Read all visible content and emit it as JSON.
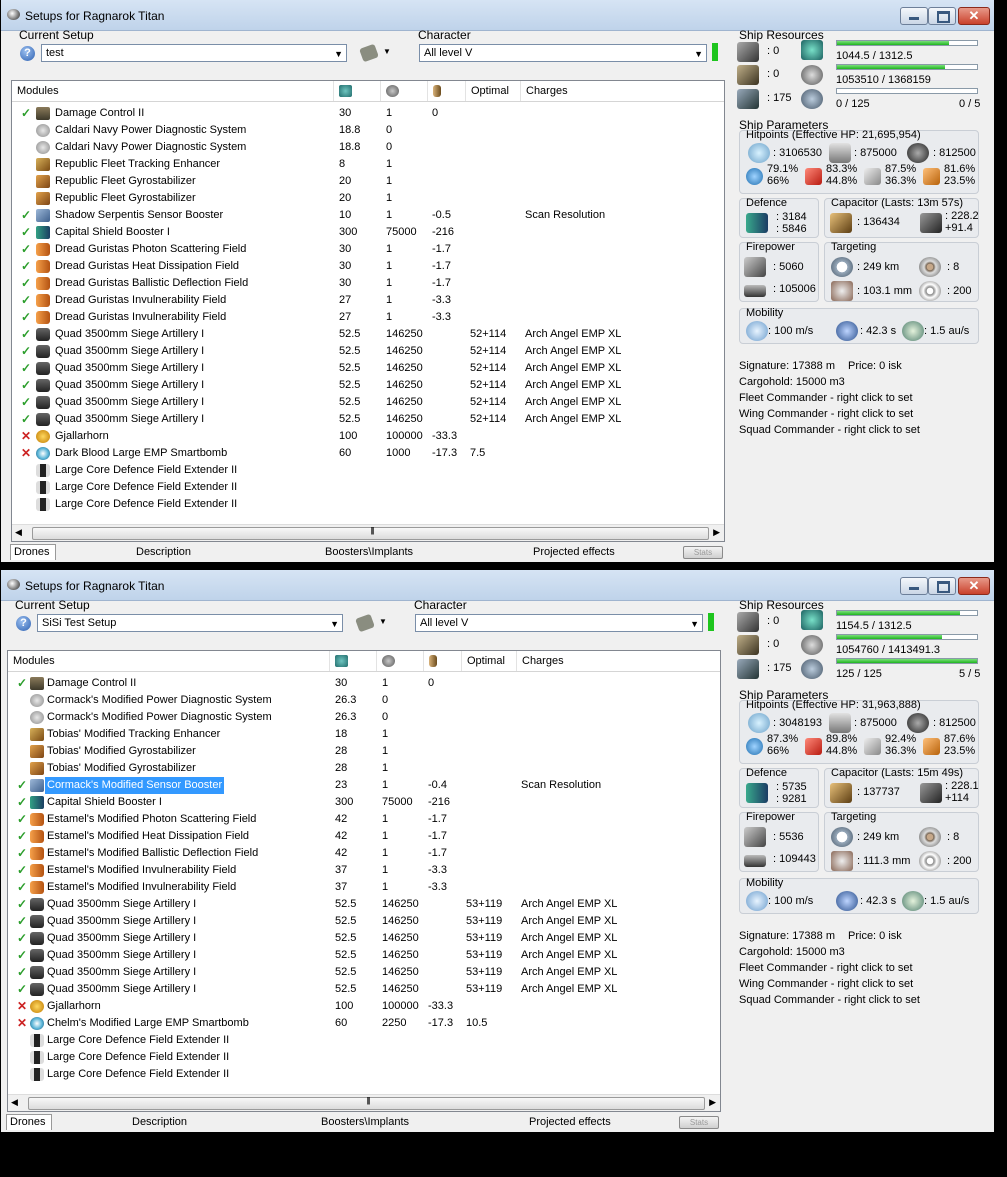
{
  "windows": [
    {
      "title": "Setups for Ragnarok Titan",
      "setup_label": "Current Setup",
      "setup_value": "test",
      "character_label": "Character",
      "character_value": "All level V",
      "columns": {
        "modules": "Modules",
        "optimal": "Optimal",
        "charges": "Charges"
      },
      "modules": [
        {
          "status": "ok",
          "icon": "damage-control-icon",
          "name": "Damage Control II",
          "cpu": "30",
          "pg": "1",
          "cap": "0",
          "optimal": "",
          "charges": ""
        },
        {
          "status": "",
          "icon": "power-diagnostic-icon",
          "name": "Caldari Navy Power Diagnostic System",
          "cpu": "18.8",
          "pg": "0",
          "cap": "",
          "optimal": "",
          "charges": ""
        },
        {
          "status": "",
          "icon": "power-diagnostic-icon",
          "name": "Caldari Navy Power Diagnostic System",
          "cpu": "18.8",
          "pg": "0",
          "cap": "",
          "optimal": "",
          "charges": ""
        },
        {
          "status": "",
          "icon": "tracking-enhancer-icon",
          "name": "Republic Fleet Tracking Enhancer",
          "cpu": "8",
          "pg": "1",
          "cap": "",
          "optimal": "",
          "charges": ""
        },
        {
          "status": "",
          "icon": "gyrostabilizer-icon",
          "name": "Republic Fleet Gyrostabilizer",
          "cpu": "20",
          "pg": "1",
          "cap": "",
          "optimal": "",
          "charges": ""
        },
        {
          "status": "",
          "icon": "gyrostabilizer-icon",
          "name": "Republic Fleet Gyrostabilizer",
          "cpu": "20",
          "pg": "1",
          "cap": "",
          "optimal": "",
          "charges": ""
        },
        {
          "status": "ok",
          "icon": "sensor-booster-icon",
          "name": "Shadow Serpentis Sensor Booster",
          "cpu": "10",
          "pg": "1",
          "cap": "-0.5",
          "optimal": "",
          "charges": "Scan Resolution"
        },
        {
          "status": "ok",
          "icon": "shield-booster-icon",
          "name": "Capital Shield Booster I",
          "cpu": "300",
          "pg": "75000",
          "cap": "-216",
          "optimal": "",
          "charges": ""
        },
        {
          "status": "ok",
          "icon": "hardener-icon",
          "name": "Dread Guristas Photon Scattering Field",
          "cpu": "30",
          "pg": "1",
          "cap": "-1.7",
          "optimal": "",
          "charges": ""
        },
        {
          "status": "ok",
          "icon": "hardener-icon",
          "name": "Dread Guristas Heat Dissipation Field",
          "cpu": "30",
          "pg": "1",
          "cap": "-1.7",
          "optimal": "",
          "charges": ""
        },
        {
          "status": "ok",
          "icon": "hardener-icon",
          "name": "Dread Guristas Ballistic Deflection Field",
          "cpu": "30",
          "pg": "1",
          "cap": "-1.7",
          "optimal": "",
          "charges": ""
        },
        {
          "status": "ok",
          "icon": "hardener-icon",
          "name": "Dread Guristas Invulnerability Field",
          "cpu": "27",
          "pg": "1",
          "cap": "-3.3",
          "optimal": "",
          "charges": ""
        },
        {
          "status": "ok",
          "icon": "hardener-icon",
          "name": "Dread Guristas Invulnerability Field",
          "cpu": "27",
          "pg": "1",
          "cap": "-3.3",
          "optimal": "",
          "charges": ""
        },
        {
          "status": "ok",
          "icon": "artillery-icon",
          "name": "Quad 3500mm Siege Artillery I",
          "cpu": "52.5",
          "pg": "146250",
          "cap": "",
          "optimal": "52+114",
          "charges": "Arch Angel EMP XL"
        },
        {
          "status": "ok",
          "icon": "artillery-icon",
          "name": "Quad 3500mm Siege Artillery I",
          "cpu": "52.5",
          "pg": "146250",
          "cap": "",
          "optimal": "52+114",
          "charges": "Arch Angel EMP XL"
        },
        {
          "status": "ok",
          "icon": "artillery-icon",
          "name": "Quad 3500mm Siege Artillery I",
          "cpu": "52.5",
          "pg": "146250",
          "cap": "",
          "optimal": "52+114",
          "charges": "Arch Angel EMP XL"
        },
        {
          "status": "ok",
          "icon": "artillery-icon",
          "name": "Quad 3500mm Siege Artillery I",
          "cpu": "52.5",
          "pg": "146250",
          "cap": "",
          "optimal": "52+114",
          "charges": "Arch Angel EMP XL"
        },
        {
          "status": "ok",
          "icon": "artillery-icon",
          "name": "Quad 3500mm Siege Artillery I",
          "cpu": "52.5",
          "pg": "146250",
          "cap": "",
          "optimal": "52+114",
          "charges": "Arch Angel EMP XL"
        },
        {
          "status": "ok",
          "icon": "artillery-icon",
          "name": "Quad 3500mm Siege Artillery I",
          "cpu": "52.5",
          "pg": "146250",
          "cap": "",
          "optimal": "52+114",
          "charges": "Arch Angel EMP XL"
        },
        {
          "status": "off",
          "icon": "doomsday-icon",
          "name": "Gjallarhorn",
          "cpu": "100",
          "pg": "100000",
          "cap": "-33.3",
          "optimal": "",
          "charges": ""
        },
        {
          "status": "off",
          "icon": "smartbomb-icon",
          "name": "Dark Blood Large EMP Smartbomb",
          "cpu": "60",
          "pg": "1000",
          "cap": "-17.3",
          "optimal": "7.5",
          "charges": ""
        },
        {
          "status": "",
          "icon": "extender-icon",
          "name": "Large Core Defence Field Extender II",
          "cpu": "",
          "pg": "",
          "cap": "",
          "optimal": "",
          "charges": ""
        },
        {
          "status": "",
          "icon": "extender-icon",
          "name": "Large Core Defence Field Extender II",
          "cpu": "",
          "pg": "",
          "cap": "",
          "optimal": "",
          "charges": ""
        },
        {
          "status": "",
          "icon": "extender-icon",
          "name": "Large Core Defence Field Extender II",
          "cpu": "",
          "pg": "",
          "cap": "",
          "optimal": "",
          "charges": ""
        }
      ],
      "tabs": [
        "Drones",
        "Description",
        "Boosters\\Implants",
        "Projected effects"
      ],
      "stats_button": "Stats",
      "resources": {
        "title": "Ship Resources",
        "turrets": ": 0",
        "launchers": ": 0",
        "drones": ": 175",
        "cpu": "1044.5 / 1312.5",
        "cpu_fill": 0.8,
        "pg": "1053510 / 1368159",
        "pg_fill": 0.77,
        "calibration": "0 / 125",
        "calibration_fill": 0.0,
        "rigs": "0 / 5"
      },
      "params": {
        "title": "Ship Parameters",
        "hitpoints": "Hitpoints (Effective HP: 21,695,954)",
        "shield_hp": ": 3106530",
        "armor_hp": ": 875000",
        "hull_hp": ": 812500",
        "res_em": "79.1%\n66%",
        "res_therm": "83.3%\n44.8%",
        "res_kin": "87.5%\n36.3%",
        "res_exp": "81.6%\n23.5%",
        "defence_title": "Defence",
        "defence_a": ": 3184",
        "defence_b": ": 5846",
        "capacitor_title": "Capacitor (Lasts: 13m 57s)",
        "capacitor_amount": ": 136434",
        "capacitor_rate": ": 228.2\n+91.4",
        "firepower_title": "Firepower",
        "firepower_a": ": 5060",
        "firepower_b": ": 105006",
        "targeting_title": "Targeting",
        "target_range": ": 249 km",
        "max_targets": ": 8",
        "scan_res": ": 103.1 mm",
        "sensor_strength": ": 200",
        "mobility_title": "Mobility",
        "speed": ": 100 m/s",
        "align": ": 42.3 s",
        "warp": ": 1.5 au/s",
        "signature": "Signature: 17388 m",
        "price": "Price: 0 isk",
        "cargohold": "Cargohold: 15000 m3",
        "fleet": "Fleet Commander - right click to set",
        "wing": "Wing Commander - right click to set",
        "squad": "Squad Commander - right click to set"
      }
    },
    {
      "title": "Setups for Ragnarok Titan",
      "setup_label": "Current Setup",
      "setup_value": "SiSi Test Setup",
      "character_label": "Character",
      "character_value": "All level V",
      "columns": {
        "modules": "Modules",
        "optimal": "Optimal",
        "charges": "Charges"
      },
      "modules": [
        {
          "status": "ok",
          "icon": "damage-control-icon",
          "name": "Damage Control II",
          "cpu": "30",
          "pg": "1",
          "cap": "0",
          "optimal": "",
          "charges": ""
        },
        {
          "status": "",
          "icon": "power-diagnostic-icon",
          "name": "Cormack's Modified Power Diagnostic System",
          "cpu": "26.3",
          "pg": "0",
          "cap": "",
          "optimal": "",
          "charges": ""
        },
        {
          "status": "",
          "icon": "power-diagnostic-icon",
          "name": "Cormack's Modified Power Diagnostic System",
          "cpu": "26.3",
          "pg": "0",
          "cap": "",
          "optimal": "",
          "charges": ""
        },
        {
          "status": "",
          "icon": "tracking-enhancer-icon",
          "name": "Tobias' Modified Tracking Enhancer",
          "cpu": "18",
          "pg": "1",
          "cap": "",
          "optimal": "",
          "charges": ""
        },
        {
          "status": "",
          "icon": "gyrostabilizer-icon",
          "name": "Tobias' Modified Gyrostabilizer",
          "cpu": "28",
          "pg": "1",
          "cap": "",
          "optimal": "",
          "charges": ""
        },
        {
          "status": "",
          "icon": "gyrostabilizer-icon",
          "name": "Tobias' Modified Gyrostabilizer",
          "cpu": "28",
          "pg": "1",
          "cap": "",
          "optimal": "",
          "charges": ""
        },
        {
          "status": "ok",
          "icon": "sensor-booster-icon",
          "name": "Cormack's Modified Sensor Booster",
          "cpu": "23",
          "pg": "1",
          "cap": "-0.4",
          "optimal": "",
          "charges": "Scan Resolution",
          "selected": true
        },
        {
          "status": "ok",
          "icon": "shield-booster-icon",
          "name": "Capital Shield Booster I",
          "cpu": "300",
          "pg": "75000",
          "cap": "-216",
          "optimal": "",
          "charges": ""
        },
        {
          "status": "ok",
          "icon": "hardener-icon",
          "name": "Estamel's Modified Photon Scattering Field",
          "cpu": "42",
          "pg": "1",
          "cap": "-1.7",
          "optimal": "",
          "charges": ""
        },
        {
          "status": "ok",
          "icon": "hardener-icon",
          "name": "Estamel's Modified Heat Dissipation Field",
          "cpu": "42",
          "pg": "1",
          "cap": "-1.7",
          "optimal": "",
          "charges": ""
        },
        {
          "status": "ok",
          "icon": "hardener-icon",
          "name": "Estamel's Modified Ballistic Deflection Field",
          "cpu": "42",
          "pg": "1",
          "cap": "-1.7",
          "optimal": "",
          "charges": ""
        },
        {
          "status": "ok",
          "icon": "hardener-icon",
          "name": "Estamel's Modified Invulnerability Field",
          "cpu": "37",
          "pg": "1",
          "cap": "-3.3",
          "optimal": "",
          "charges": ""
        },
        {
          "status": "ok",
          "icon": "hardener-icon",
          "name": "Estamel's Modified Invulnerability Field",
          "cpu": "37",
          "pg": "1",
          "cap": "-3.3",
          "optimal": "",
          "charges": ""
        },
        {
          "status": "ok",
          "icon": "artillery-icon",
          "name": "Quad 3500mm Siege Artillery I",
          "cpu": "52.5",
          "pg": "146250",
          "cap": "",
          "optimal": "53+119",
          "charges": "Arch Angel EMP XL"
        },
        {
          "status": "ok",
          "icon": "artillery-icon",
          "name": "Quad 3500mm Siege Artillery I",
          "cpu": "52.5",
          "pg": "146250",
          "cap": "",
          "optimal": "53+119",
          "charges": "Arch Angel EMP XL"
        },
        {
          "status": "ok",
          "icon": "artillery-icon",
          "name": "Quad 3500mm Siege Artillery I",
          "cpu": "52.5",
          "pg": "146250",
          "cap": "",
          "optimal": "53+119",
          "charges": "Arch Angel EMP XL"
        },
        {
          "status": "ok",
          "icon": "artillery-icon",
          "name": "Quad 3500mm Siege Artillery I",
          "cpu": "52.5",
          "pg": "146250",
          "cap": "",
          "optimal": "53+119",
          "charges": "Arch Angel EMP XL"
        },
        {
          "status": "ok",
          "icon": "artillery-icon",
          "name": "Quad 3500mm Siege Artillery I",
          "cpu": "52.5",
          "pg": "146250",
          "cap": "",
          "optimal": "53+119",
          "charges": "Arch Angel EMP XL"
        },
        {
          "status": "ok",
          "icon": "artillery-icon",
          "name": "Quad 3500mm Siege Artillery I",
          "cpu": "52.5",
          "pg": "146250",
          "cap": "",
          "optimal": "53+119",
          "charges": "Arch Angel EMP XL"
        },
        {
          "status": "off",
          "icon": "doomsday-icon",
          "name": "Gjallarhorn",
          "cpu": "100",
          "pg": "100000",
          "cap": "-33.3",
          "optimal": "",
          "charges": ""
        },
        {
          "status": "off",
          "icon": "smartbomb-icon",
          "name": "Chelm's Modified Large EMP Smartbomb",
          "cpu": "60",
          "pg": "2250",
          "cap": "-17.3",
          "optimal": "10.5",
          "charges": ""
        },
        {
          "status": "",
          "icon": "extender-icon",
          "name": "Large Core Defence Field Extender II",
          "cpu": "",
          "pg": "",
          "cap": "",
          "optimal": "",
          "charges": ""
        },
        {
          "status": "",
          "icon": "extender-icon",
          "name": "Large Core Defence Field Extender II",
          "cpu": "",
          "pg": "",
          "cap": "",
          "optimal": "",
          "charges": ""
        },
        {
          "status": "",
          "icon": "extender-icon",
          "name": "Large Core Defence Field Extender II",
          "cpu": "",
          "pg": "",
          "cap": "",
          "optimal": "",
          "charges": ""
        }
      ],
      "tabs": [
        "Drones",
        "Description",
        "Boosters\\Implants",
        "Projected effects"
      ],
      "stats_button": "Stats",
      "resources": {
        "title": "Ship Resources",
        "turrets": ": 0",
        "launchers": ": 0",
        "drones": ": 175",
        "cpu": "1154.5 / 1312.5",
        "cpu_fill": 0.88,
        "pg": "1054760 / 1413491.3",
        "pg_fill": 0.75,
        "calibration": "125 / 125",
        "calibration_fill": 1.0,
        "rigs": "5 / 5"
      },
      "params": {
        "title": "Ship Parameters",
        "hitpoints": "Hitpoints (Effective HP: 31,963,888)",
        "shield_hp": ": 3048193",
        "armor_hp": ": 875000",
        "hull_hp": ": 812500",
        "res_em": "87.3%\n66%",
        "res_therm": "89.8%\n44.8%",
        "res_kin": "92.4%\n36.3%",
        "res_exp": "87.6%\n23.5%",
        "defence_title": "Defence",
        "defence_a": ": 5735",
        "defence_b": ": 9281",
        "capacitor_title": "Capacitor (Lasts: 15m 49s)",
        "capacitor_amount": ": 137737",
        "capacitor_rate": ": 228.1\n+114",
        "firepower_title": "Firepower",
        "firepower_a": ": 5536",
        "firepower_b": ": 109443",
        "targeting_title": "Targeting",
        "target_range": ": 249 km",
        "max_targets": ": 8",
        "scan_res": ": 111.3 mm",
        "sensor_strength": ": 200",
        "mobility_title": "Mobility",
        "speed": ": 100 m/s",
        "align": ": 42.3 s",
        "warp": ": 1.5 au/s",
        "signature": "Signature: 17388 m",
        "price": "Price: 0 isk",
        "cargohold": "Cargohold: 15000 m3",
        "fleet": "Fleet Commander - right click to set",
        "wing": "Wing Commander - right click to set",
        "squad": "Squad Commander - right click to set"
      }
    }
  ]
}
